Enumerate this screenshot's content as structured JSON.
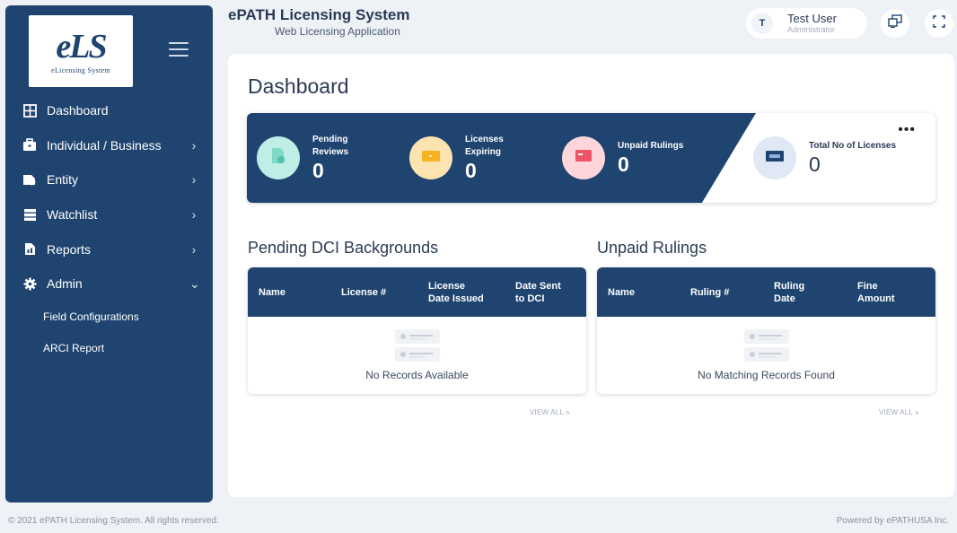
{
  "sidebar": {
    "logo_text": "eLS",
    "logo_subtitle": "eLicensing System",
    "items": [
      {
        "label": "Dashboard",
        "icon": "dashboard-icon",
        "chevron": ""
      },
      {
        "label": "Individual / Business",
        "icon": "briefcase-icon",
        "chevron": "›"
      },
      {
        "label": "Entity",
        "icon": "entity-icon",
        "chevron": "›"
      },
      {
        "label": "Watchlist",
        "icon": "list-icon",
        "chevron": "›"
      },
      {
        "label": "Reports",
        "icon": "report-icon",
        "chevron": "›"
      },
      {
        "label": "Admin",
        "icon": "gear-icon",
        "chevron": "⌄"
      }
    ],
    "subitems": [
      {
        "label": "Field Configurations"
      },
      {
        "label": "ARCI Report"
      }
    ]
  },
  "header": {
    "title": "ePATH Licensing System",
    "subtitle": "Web Licensing Application",
    "user_initial": "T",
    "user_name": "Test User",
    "user_role": "Administrator"
  },
  "main": {
    "page_title": "Dashboard",
    "stats": [
      {
        "label_line1": "Pending",
        "label_line2": "Reviews",
        "value": "0",
        "color": "#bfeee6",
        "icon": "document-icon"
      },
      {
        "label_line1": "Licenses",
        "label_line2": "Expiring",
        "value": "0",
        "color": "#fde3b0",
        "icon": "card-icon"
      },
      {
        "label_line1": "Unpaid Rulings",
        "label_line2": "",
        "value": "0",
        "color": "#fcd6da",
        "icon": "receipt-icon"
      },
      {
        "label_line1": "Total No of Licenses",
        "label_line2": "",
        "value": "0",
        "color": "#dfe8f4",
        "icon": "license-icon"
      }
    ],
    "more_label": "•••",
    "dci": {
      "title": "Pending DCI Backgrounds",
      "columns": [
        {
          "line1": "Name",
          "line2": ""
        },
        {
          "line1": "License #",
          "line2": ""
        },
        {
          "line1": "License",
          "line2": "Date Issued"
        },
        {
          "line1": "Date Sent",
          "line2": "to DCI"
        }
      ],
      "empty_text": "No Records Available",
      "view_all": "VIEW ALL »"
    },
    "rulings": {
      "title": "Unpaid Rulings",
      "columns": [
        {
          "line1": "Name",
          "line2": ""
        },
        {
          "line1": "Ruling #",
          "line2": ""
        },
        {
          "line1": "Ruling",
          "line2": "Date"
        },
        {
          "line1": "Fine",
          "line2": "Amount"
        }
      ],
      "empty_text": "No Matching Records Found",
      "view_all": "VIEW ALL »"
    }
  },
  "footer": {
    "copyright": "© 2021 ePATH Licensing System. All rights reserved.",
    "powered_by": "Powered by ePATHUSA Inc."
  },
  "colors": {
    "primary": "#1f4470",
    "background": "#eef1f6"
  }
}
